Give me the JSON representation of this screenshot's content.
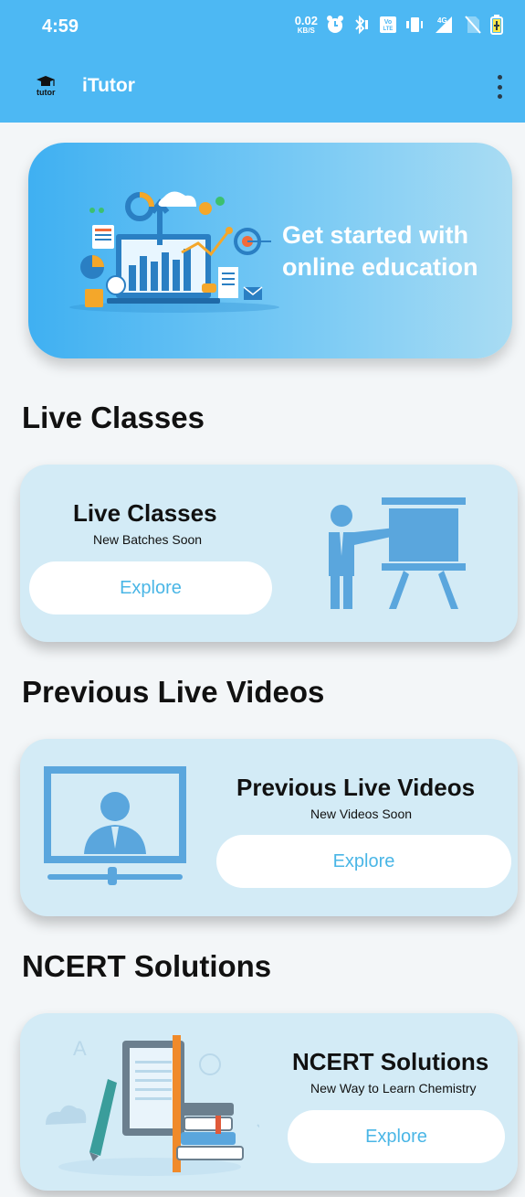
{
  "status_bar": {
    "time": "4:59",
    "net_speed_top": "0.02",
    "net_speed_bottom": "KB/S",
    "net_label": "4G",
    "volte_top": "Vo",
    "volte_bottom": "LTE"
  },
  "app_bar": {
    "logo_text": "tutor",
    "title": "iTutor"
  },
  "hero": {
    "line1": "Get started with",
    "line2": "online education"
  },
  "sections": {
    "live": {
      "heading": "Live Classes",
      "card_title": "Live Classes",
      "card_subtitle": "New Batches Soon",
      "button": "Explore"
    },
    "previous": {
      "heading": "Previous Live Videos",
      "card_title": "Previous Live Videos",
      "card_subtitle": "New Videos Soon",
      "button": "Explore"
    },
    "ncert": {
      "heading": "NCERT Solutions",
      "card_title": "NCERT Solutions",
      "card_subtitle": "New Way to Learn Chemistry",
      "button": "Explore"
    }
  },
  "colors": {
    "primary": "#4db8f3",
    "card": "#d3ebf6",
    "button_text": "#4ab6e6",
    "illustration": "#5aa6dd"
  }
}
